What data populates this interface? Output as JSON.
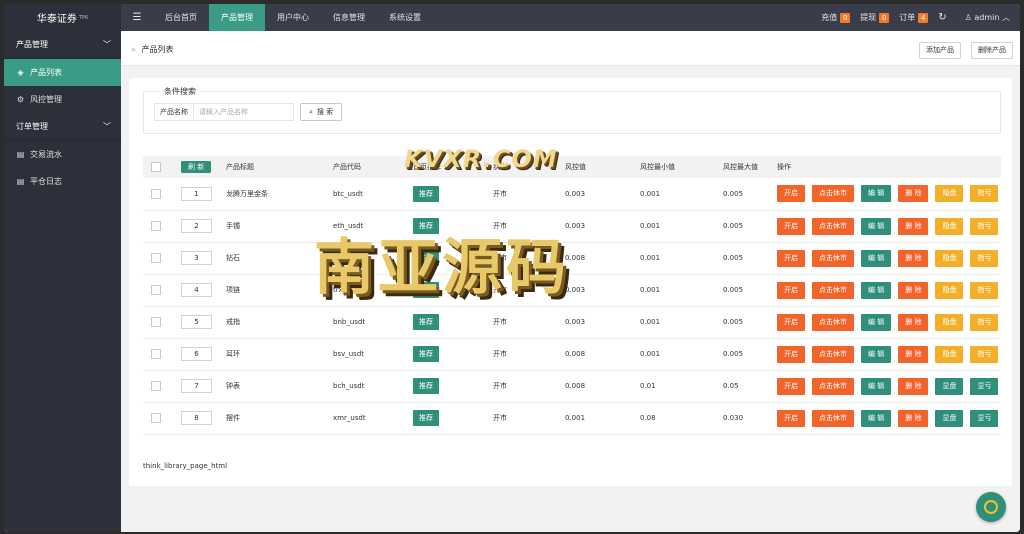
{
  "brand": {
    "name": "华泰证券",
    "tag": "TP6"
  },
  "topnav": [
    {
      "label": "☰",
      "icon": "menu-icon"
    },
    {
      "label": "后台首页"
    },
    {
      "label": "产品管理",
      "active": true
    },
    {
      "label": "用户中心"
    },
    {
      "label": "信息管理"
    },
    {
      "label": "系统设置"
    }
  ],
  "topright": {
    "recharge": {
      "label": "充值",
      "count": "0"
    },
    "withdraw": {
      "label": "提现",
      "count": "0"
    },
    "orders": {
      "label": "订单",
      "count": "4"
    },
    "user": "admin"
  },
  "sidebar": {
    "group1": "产品管理",
    "item_product_list": "产品列表",
    "item_risk": "风控管理",
    "group2": "订单管理",
    "item_trade_flow": "交易流水",
    "item_close_log": "平仓日志"
  },
  "breadcrumb": "产品列表",
  "toolbar": {
    "add": "添加产品",
    "delete": "删除产品"
  },
  "search": {
    "legend": "条件搜索",
    "label": "产品名称",
    "placeholder": "请输入产品名称",
    "button": "搜 索"
  },
  "table": {
    "refresh": "刷 新",
    "headers": [
      "产品标题",
      "产品代码",
      "首页推荐",
      "状态",
      "风控值",
      "风控最小值",
      "风控最大值",
      "操作"
    ],
    "rows": [
      {
        "sort": "1",
        "title": "龙腾万里金条",
        "code": "btc_usdt",
        "rec": "推荐",
        "status": "开市",
        "risk": "0.003",
        "min": "0.001",
        "max": "0.005",
        "op5": "隐盘",
        "op6": "指亏"
      },
      {
        "sort": "2",
        "title": "手镯",
        "code": "eth_usdt",
        "rec": "推荐",
        "status": "开市",
        "risk": "0.003",
        "min": "0.001",
        "max": "0.005",
        "op5": "隐盘",
        "op6": "指亏"
      },
      {
        "sort": "3",
        "title": "钻石",
        "code": "xrp_usdt",
        "rec": "推荐",
        "status": "开市",
        "risk": "0.008",
        "min": "0.001",
        "max": "0.005",
        "op5": "隐盘",
        "op6": "指亏"
      },
      {
        "sort": "4",
        "title": "项链",
        "code": "trx_usdt",
        "rec": "推荐",
        "status": "开市",
        "risk": "0.003",
        "min": "0.001",
        "max": "0.005",
        "op5": "隐盘",
        "op6": "指亏"
      },
      {
        "sort": "5",
        "title": "戒指",
        "code": "bnb_usdt",
        "rec": "推荐",
        "status": "开市",
        "risk": "0.003",
        "min": "0.001",
        "max": "0.005",
        "op5": "隐盘",
        "op6": "指亏"
      },
      {
        "sort": "6",
        "title": "耳环",
        "code": "bsv_usdt",
        "rec": "推荐",
        "status": "开市",
        "risk": "0.008",
        "min": "0.001",
        "max": "0.005",
        "op5": "隐盘",
        "op6": "指亏"
      },
      {
        "sort": "7",
        "title": "钟表",
        "code": "bch_usdt",
        "rec": "推荐",
        "status": "开市",
        "risk": "0.008",
        "min": "0.01",
        "max": "0.05",
        "op5": "显盘",
        "op6": "显亏"
      },
      {
        "sort": "8",
        "title": "摆件",
        "code": "xmr_usdt",
        "rec": "推荐",
        "status": "开市",
        "risk": "0.001",
        "min": "0.08",
        "max": "0.030",
        "op5": "显盘",
        "op6": "显亏"
      }
    ],
    "ops": {
      "open": "开启",
      "close": "点击休市",
      "edit": "编 辑",
      "delete": "删 除"
    }
  },
  "pager_text": "think_library_page_html",
  "watermark": {
    "small": "KVXR.COM",
    "big": "南亚源码"
  }
}
